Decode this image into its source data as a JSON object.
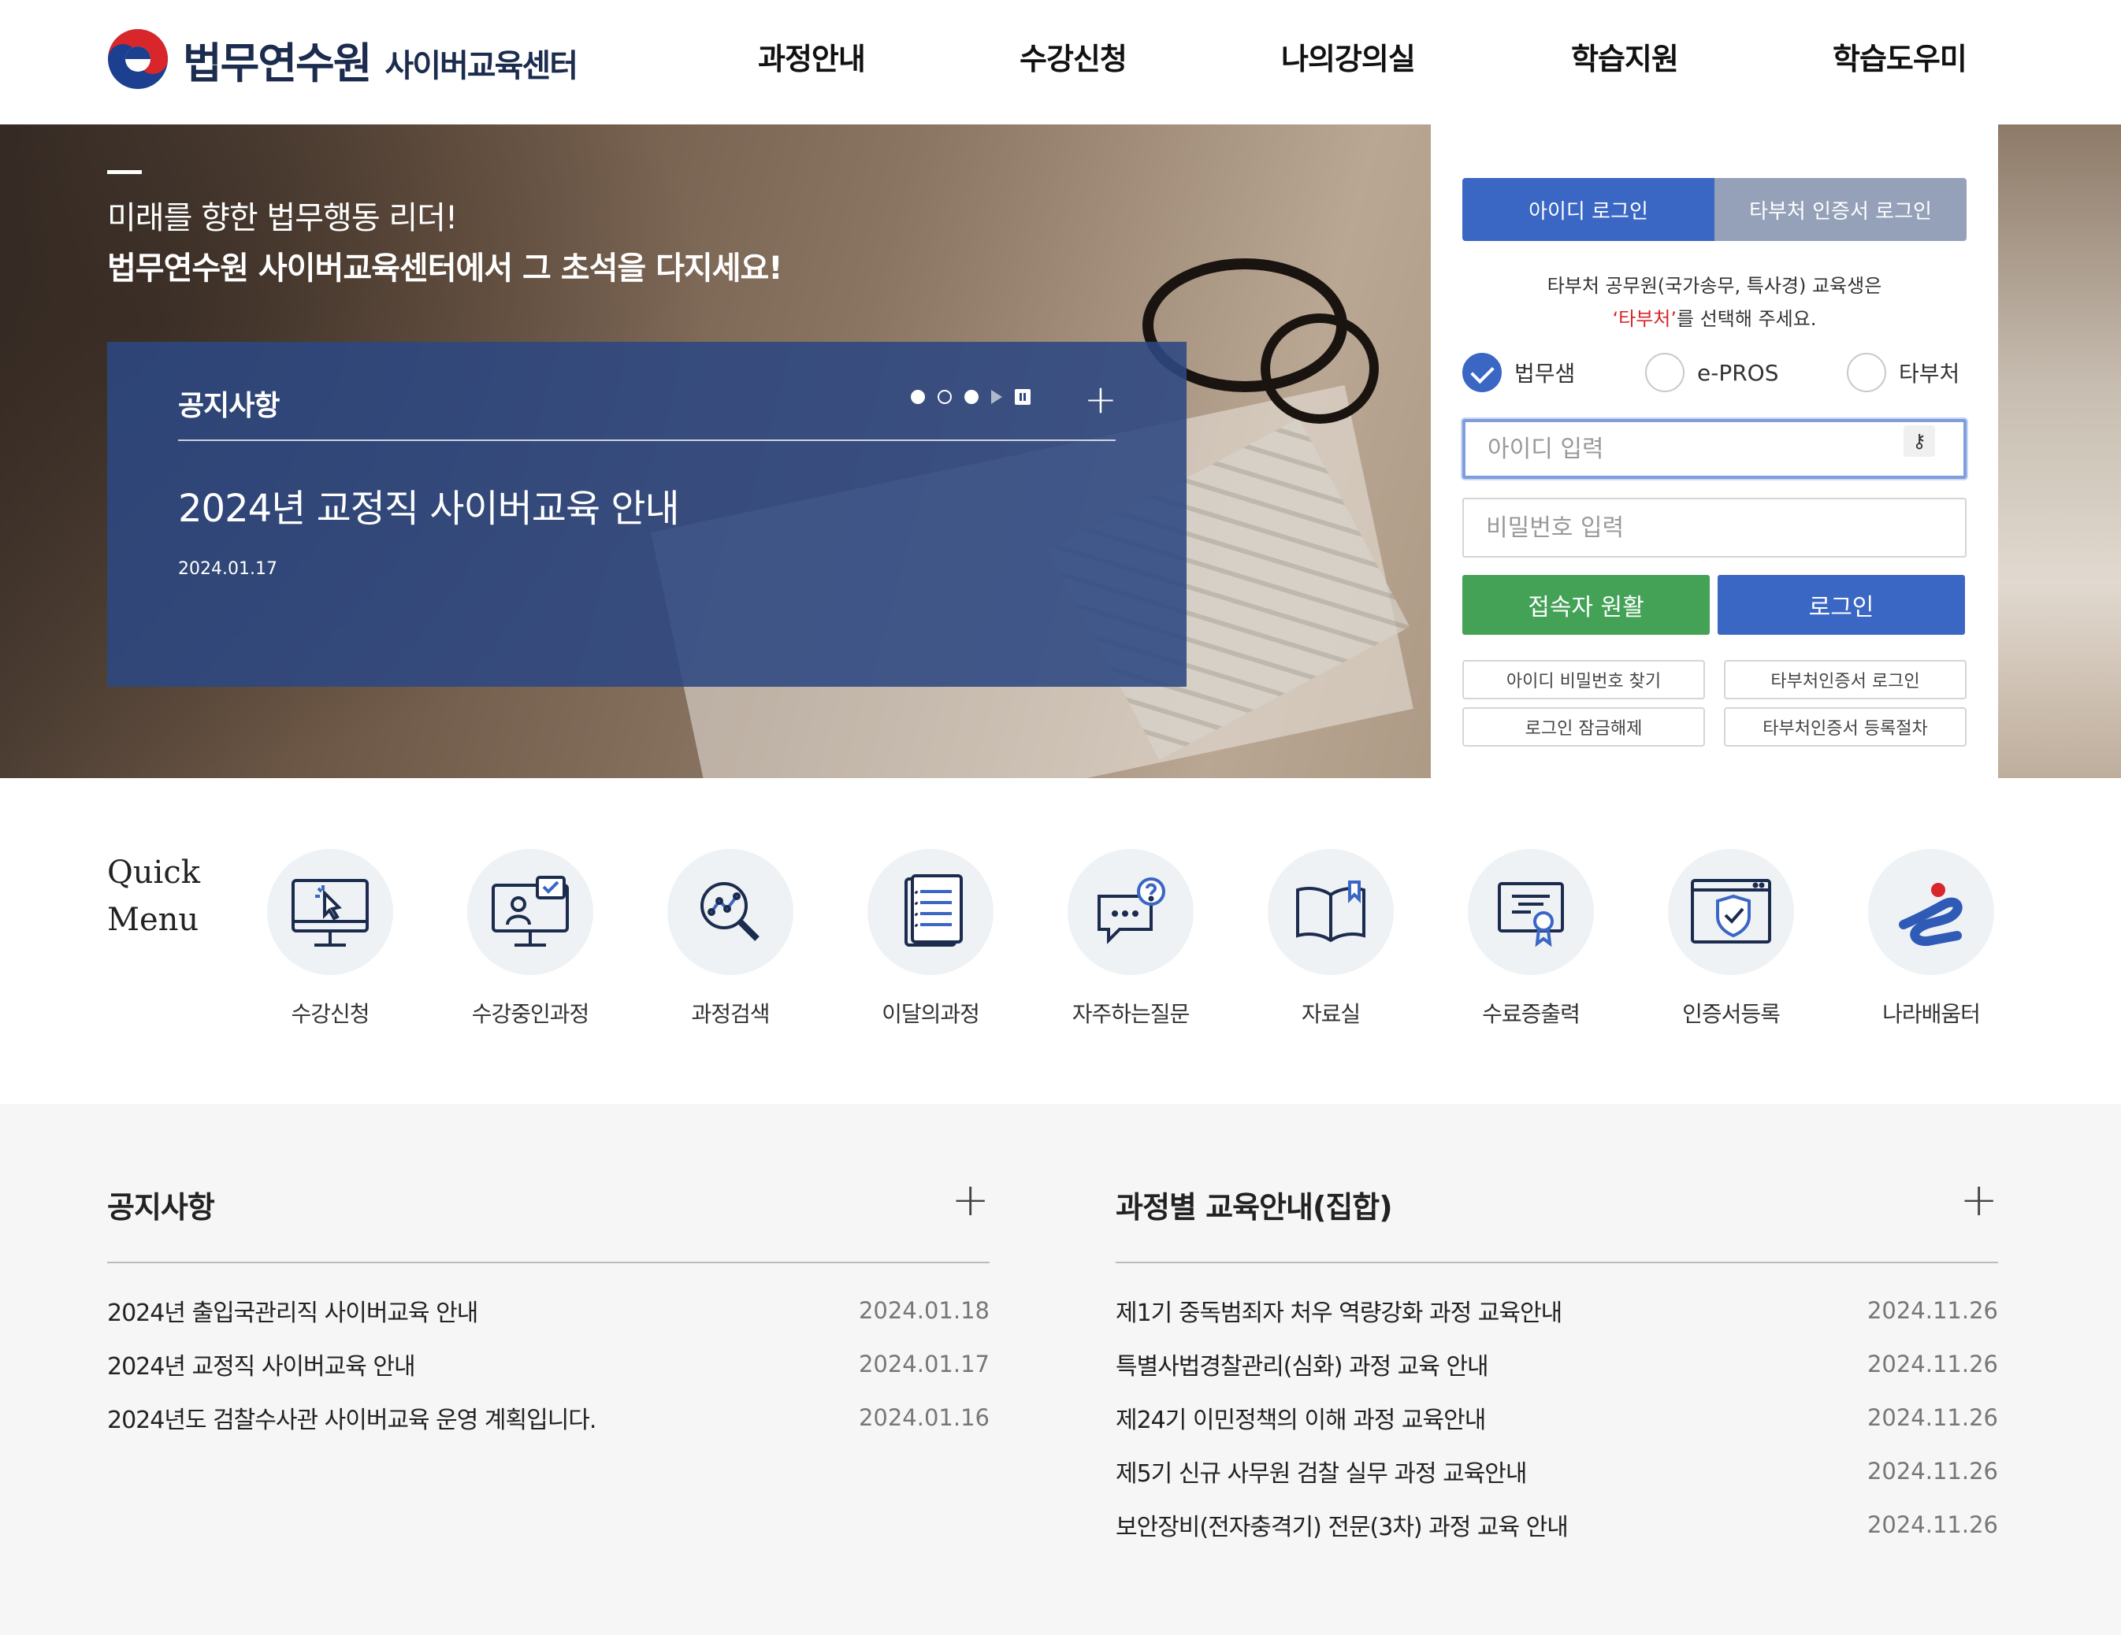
{
  "header": {
    "logo_main": "법무연수원",
    "logo_sub": "사이버교육센터",
    "nav": [
      "과정안내",
      "수강신청",
      "나의강의실",
      "학습지원",
      "학습도우미"
    ]
  },
  "hero": {
    "line1": "미래를 향한 법무행동 리더!",
    "line2": "법무연수원 사이버교육센터에서 그 초석을 다지세요!",
    "notice": {
      "title": "공지사항",
      "headline": "2024년 교정직 사이버교육 안내",
      "date": "2024.01.17",
      "plus": "+"
    }
  },
  "login": {
    "tab_id": "아이디 로그인",
    "tab_cert": "타부처 인증서 로그인",
    "msg_line1": "타부처 공무원(국가송무, 특사경) 교육생은",
    "msg_red": "‘타부처’",
    "msg_rest": "를 선택해 주세요.",
    "radio1": "법무샘",
    "radio2": "e-PROS",
    "radio3": "타부처",
    "id_placeholder": "아이디 입력",
    "pw_placeholder": "비밀번호 입력",
    "btn_status": "접속자 원활",
    "btn_login": "로그인",
    "link1": "아이디 비밀번호 찾기",
    "link2": "타부처인증서 로그인",
    "link3": "로그인 잠금해제",
    "link4": "타부처인증서 등록절차"
  },
  "quick": {
    "title_line1": "Quick",
    "title_line2": "Menu",
    "items": [
      {
        "label": "수강신청",
        "icon": "monitor-cursor-icon"
      },
      {
        "label": "수강중인과정",
        "icon": "monitor-person-icon"
      },
      {
        "label": "과정검색",
        "icon": "search-chart-icon"
      },
      {
        "label": "이달의과정",
        "icon": "document-list-icon"
      },
      {
        "label": "자주하는질문",
        "icon": "chat-question-icon"
      },
      {
        "label": "자료실",
        "icon": "book-icon"
      },
      {
        "label": "수료증출력",
        "icon": "certificate-icon"
      },
      {
        "label": "인증서등록",
        "icon": "shield-window-icon"
      },
      {
        "label": "나라배움터",
        "icon": "narabaeumteo-logo-icon"
      }
    ]
  },
  "boards": {
    "notice": {
      "title": "공지사항",
      "plus": "+",
      "rows": [
        {
          "title": "2024년 출입국관리직 사이버교육 안내",
          "date": "2024.01.18"
        },
        {
          "title": "2024년 교정직 사이버교육 안내",
          "date": "2024.01.17"
        },
        {
          "title": "2024년도 검찰수사관 사이버교육 운영 계획입니다.",
          "date": "2024.01.16"
        }
      ]
    },
    "course": {
      "title": "과정별 교육안내(집합)",
      "plus": "+",
      "rows": [
        {
          "title": "제1기 중독범죄자 처우 역량강화 과정 교육안내",
          "date": "2024.11.26"
        },
        {
          "title": "특별사법경찰관리(심화) 과정 교육 안내",
          "date": "2024.11.26"
        },
        {
          "title": "제24기 이민정책의 이해 과정 교육안내",
          "date": "2024.11.26"
        },
        {
          "title": "제5기 신규 사무원 검찰 실무 과정 교육안내",
          "date": "2024.11.26"
        },
        {
          "title": "보안장비(전자충격기) 전문(3차) 과정 교육 안내",
          "date": "2024.11.26"
        }
      ]
    }
  },
  "colors": {
    "primary_blue": "#3a66c4",
    "green": "#43a256",
    "notice_overlay": "#2c4882",
    "red": "#d8262b"
  }
}
